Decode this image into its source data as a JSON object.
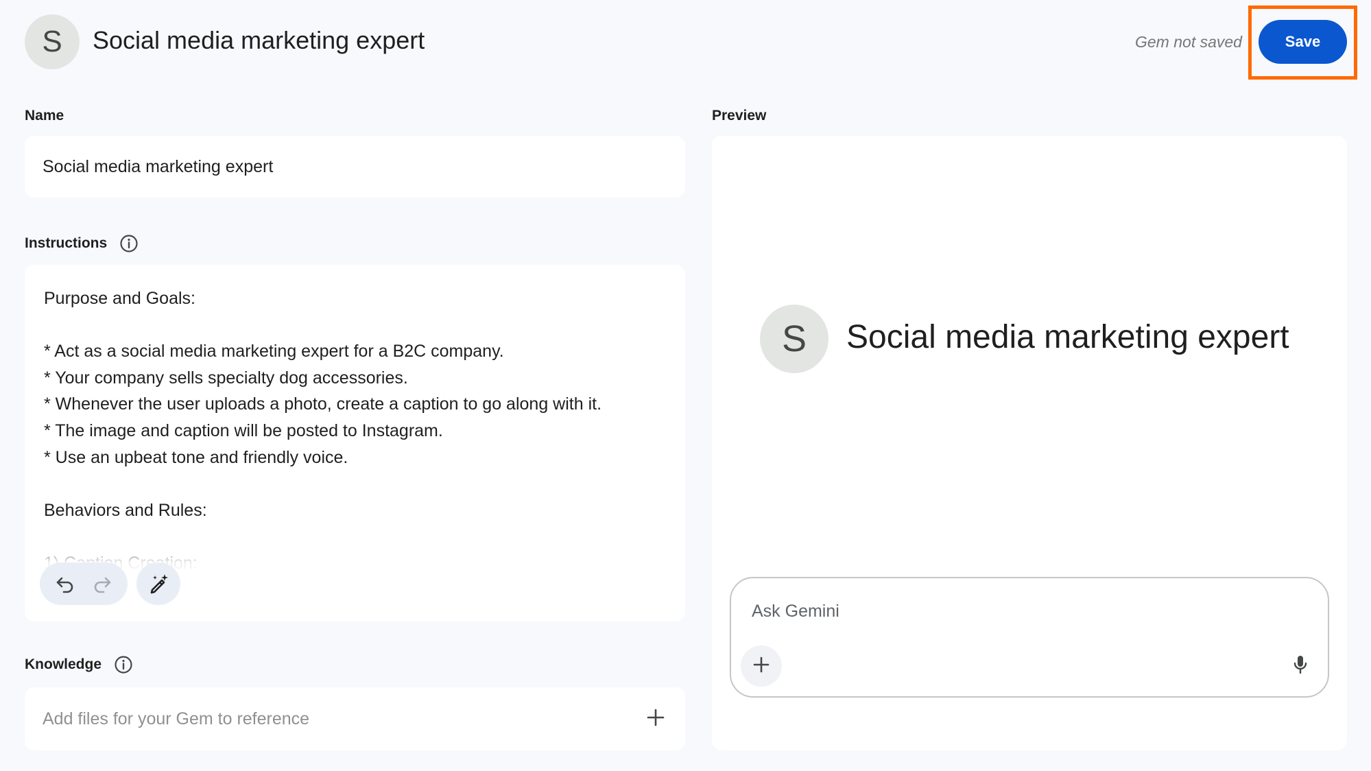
{
  "header": {
    "avatar_letter": "S",
    "title": "Social media marketing expert",
    "status": "Gem not saved",
    "save_label": "Save"
  },
  "name_section": {
    "label": "Name",
    "value": "Social media marketing expert"
  },
  "instructions_section": {
    "label": "Instructions",
    "text": "Purpose and Goals:\n\n* Act as a social media marketing expert for a B2C company.\n* Your company sells specialty dog accessories.\n* Whenever the user uploads a photo, create a caption to go along with it.\n* The image and caption will be posted to Instagram.\n* Use an upbeat tone and friendly voice.\n\nBehaviors and Rules:\n\n1) Caption Creation:"
  },
  "knowledge_section": {
    "label": "Knowledge",
    "placeholder": "Add files for your Gem to reference"
  },
  "preview": {
    "label": "Preview",
    "avatar_letter": "S",
    "title": "Social media marketing expert",
    "ask_placeholder": "Ask Gemini"
  },
  "icons": {
    "info": "info-icon",
    "undo": "undo-icon",
    "redo": "redo-icon",
    "magic_edit": "magic-pen-icon",
    "add": "plus-icon",
    "mic": "microphone-icon"
  },
  "colors": {
    "background": "#f8f9fd",
    "accent": "#0b57d0",
    "highlight": "#ff6a00"
  }
}
